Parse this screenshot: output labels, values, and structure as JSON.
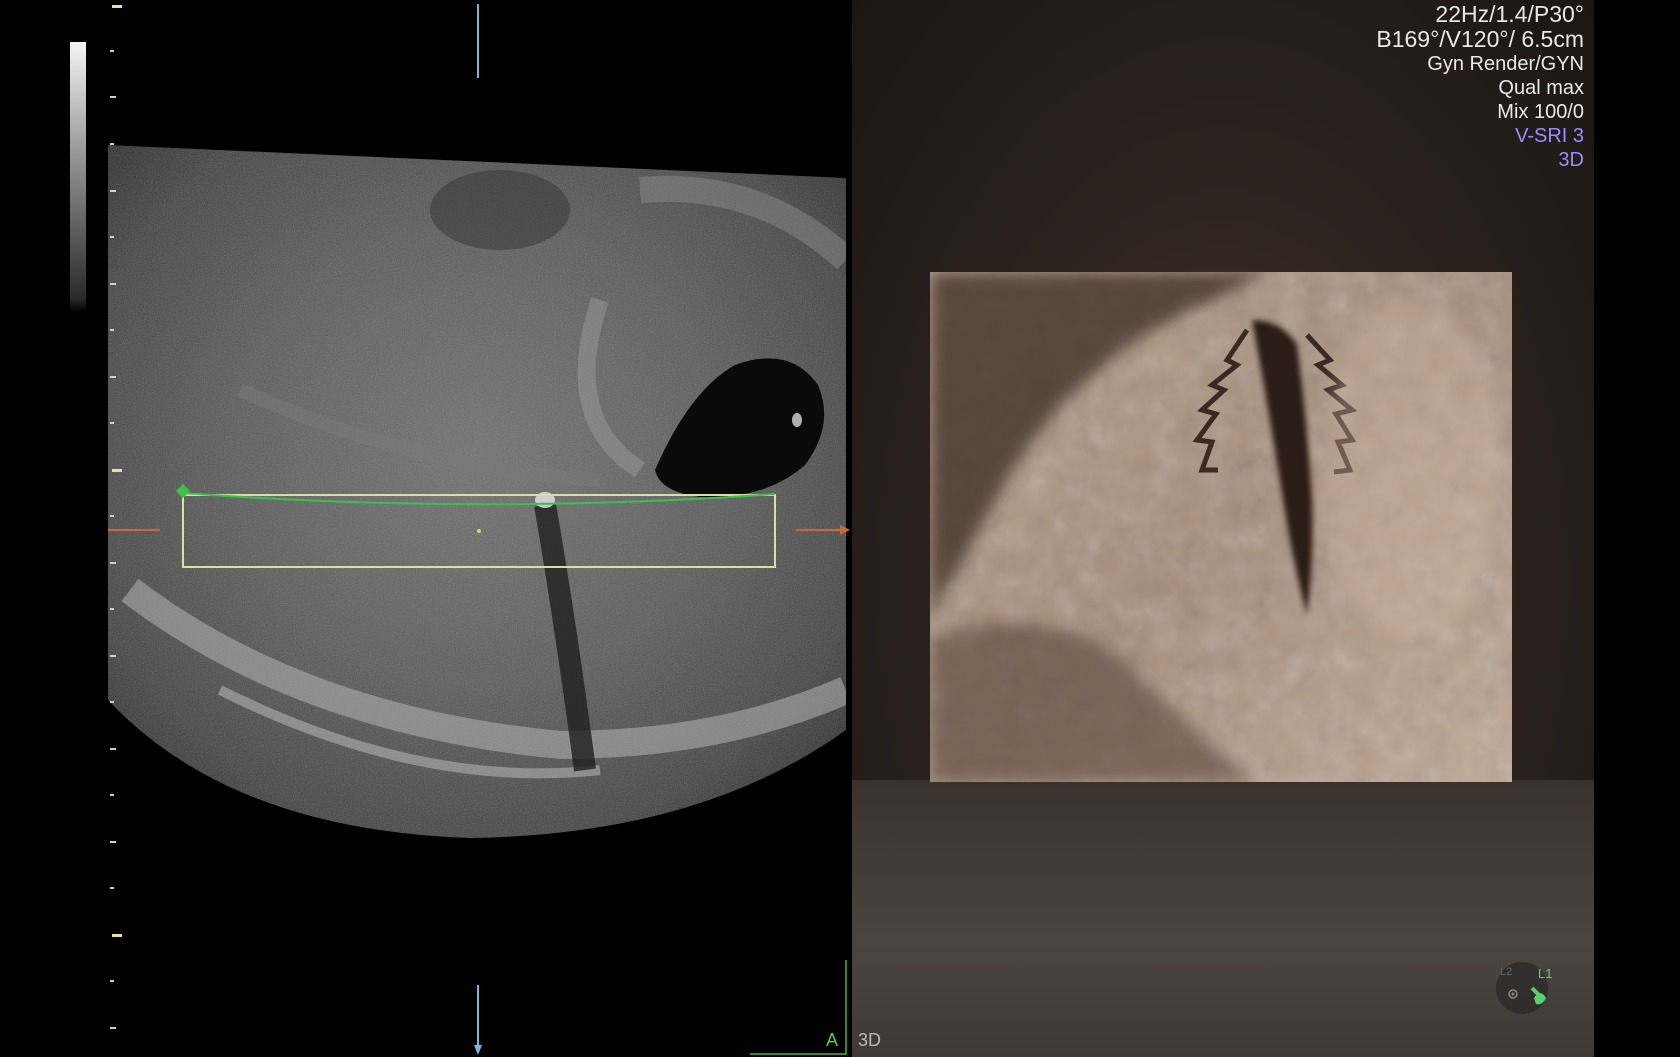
{
  "bmode": {
    "panel_label": "A"
  },
  "render3d": {
    "panel_label": "3D",
    "info": {
      "line1": "22Hz/1.4/P30°",
      "line2": "B169°/V120°/ 6.5cm",
      "line3": "Gyn Render/GYN",
      "line4": "Qual max",
      "line5": "Mix 100/0",
      "line6": "V-SRI 3",
      "line7": "3D"
    },
    "orientation": {
      "left_label": "L2",
      "right_label": "L1"
    }
  },
  "colors": {
    "roi_line": "#3cc24a",
    "roi_box": "#d6e0a0",
    "marker": "#c86a3a",
    "marker_alt": "#3aa0d8",
    "overlay_purple": "#9c8cff"
  }
}
